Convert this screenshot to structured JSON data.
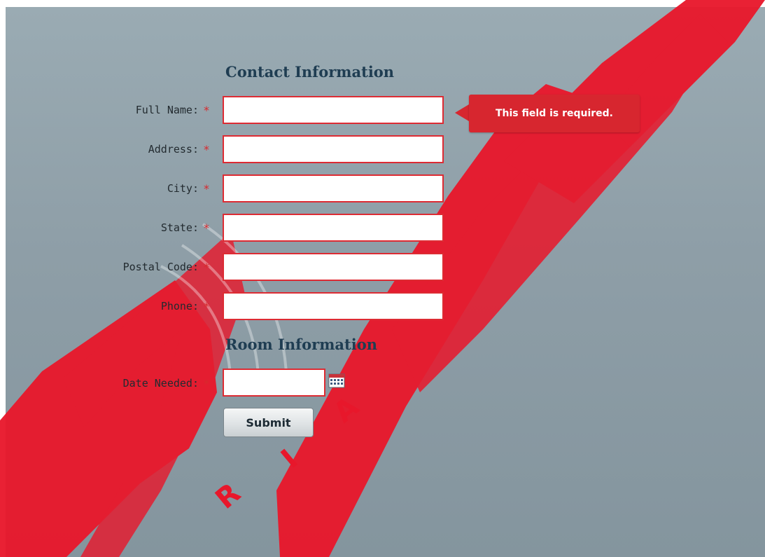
{
  "form": {
    "contact_title": "Contact Information",
    "room_title": "Room Information",
    "required_marker": "*",
    "fields": {
      "full_name": {
        "label": "Full Name:",
        "value": ""
      },
      "address": {
        "label": "Address:",
        "value": ""
      },
      "city": {
        "label": "City:",
        "value": ""
      },
      "state": {
        "label": "State:",
        "value": ""
      },
      "postal_code": {
        "label": "Postal Code:",
        "value": ""
      },
      "phone": {
        "label": "Phone:",
        "value": ""
      },
      "date_needed": {
        "label": "Date Needed:",
        "value": ""
      }
    },
    "validation_message": "This field is required.",
    "submit_label": "Submit"
  },
  "icons": {
    "date_picker": "calendar-icon"
  },
  "colors": {
    "error_red": "#d7262f",
    "title_blue": "#1f3d52",
    "background_top": "#9aabb3",
    "background_bottom": "#84959e"
  }
}
